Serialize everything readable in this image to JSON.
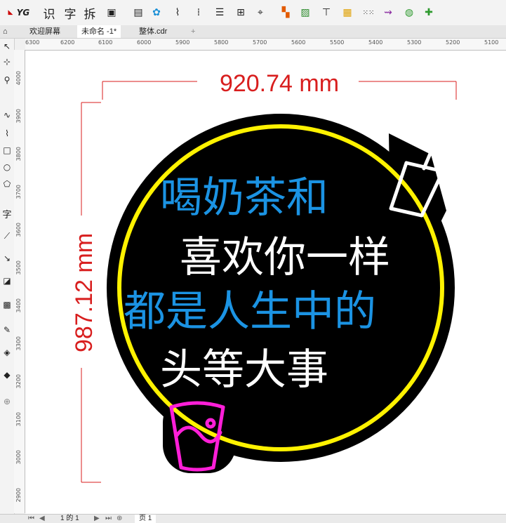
{
  "toolbar": {
    "btn_text_1": "识",
    "btn_text_2": "字",
    "btn_text_3": "拆",
    "logo_label": "YG"
  },
  "tabs": [
    {
      "label": "欢迎屏幕"
    },
    {
      "label": "未命名 -1*"
    },
    {
      "label": "整体.cdr"
    },
    {
      "label": "+"
    }
  ],
  "ruler": {
    "h_labels": [
      "6300",
      "6200",
      "6100",
      "6000",
      "5900",
      "5800",
      "5700",
      "5600",
      "5500",
      "5400",
      "5300",
      "5200",
      "5100"
    ],
    "v_labels": [
      "4000",
      "3900",
      "3800",
      "3700",
      "3600",
      "3500",
      "3400",
      "3300",
      "3200",
      "3100",
      "3000",
      "2900",
      "2800"
    ]
  },
  "drawing": {
    "width_dim": "920.74 mm",
    "height_dim": "987.12 mm",
    "line1": "喝奶茶和",
    "line2": "喜欢你一样",
    "line3": "都是人生中的",
    "line4": "头等大事",
    "colors": {
      "blue": "#1b93e3",
      "white": "#ffffff",
      "yellow": "#fff200",
      "magenta": "#ff1fd8",
      "dimension": "#d81e1e",
      "black": "#000000"
    }
  },
  "status": {
    "page_counter": "1 的 1",
    "page_tab": "页 1"
  }
}
